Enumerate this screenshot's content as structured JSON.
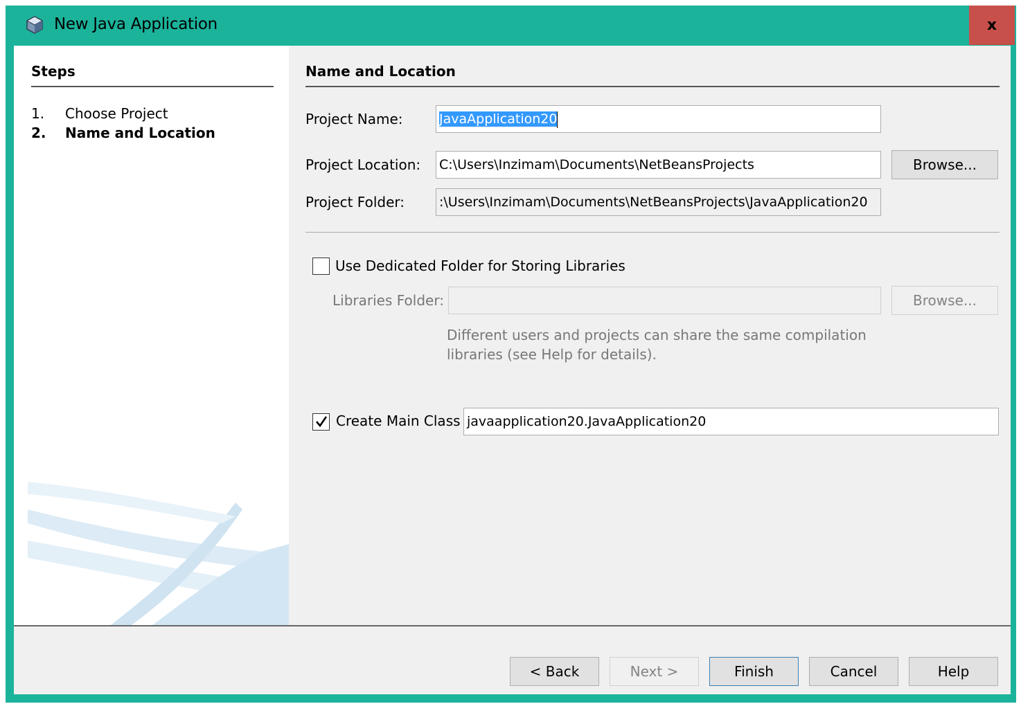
{
  "window": {
    "title": "New Java Application",
    "close_label": "x"
  },
  "steps": {
    "title": "Steps",
    "items": [
      {
        "number": "1.",
        "label": "Choose Project"
      },
      {
        "number": "2.",
        "label": "Name and Location"
      }
    ]
  },
  "form": {
    "section_title": "Name and Location",
    "project_name": {
      "label": "Project Name:",
      "value": "JavaApplication20"
    },
    "project_location": {
      "label": "Project Location:",
      "value": "C:\\Users\\Inzimam\\Documents\\NetBeansProjects",
      "browse_label": "Browse..."
    },
    "project_folder": {
      "label": "Project Folder:",
      "value": ":\\Users\\Inzimam\\Documents\\NetBeansProjects\\JavaApplication20"
    },
    "dedicated_folder": {
      "label": "Use Dedicated Folder for Storing Libraries",
      "checked": false
    },
    "libraries_folder": {
      "label": "Libraries Folder:",
      "value": "",
      "browse_label": "Browse..."
    },
    "libraries_help": "Different users and projects can share the same compilation libraries (see Help for details).",
    "main_class": {
      "label": "Create Main Class",
      "checked": true,
      "value": "javaapplication20.JavaApplication20"
    }
  },
  "buttons": {
    "back": "< Back",
    "next": "Next >",
    "finish": "Finish",
    "cancel": "Cancel",
    "help": "Help"
  },
  "colors": {
    "titlebar": "#1cb39b",
    "close": "#c7504a",
    "selection": "#3399ff"
  }
}
